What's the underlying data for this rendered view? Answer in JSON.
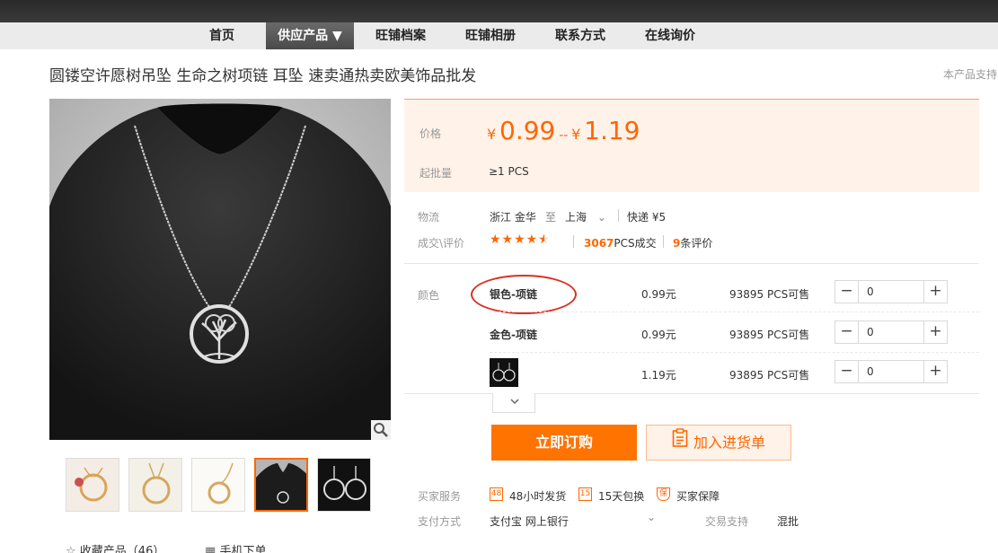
{
  "nav": {
    "items": [
      "首页",
      "供应产品 ▼",
      "旺铺档案",
      "旺铺相册",
      "联系方式",
      "在线询价"
    ]
  },
  "product": {
    "title": "圆镂空许愿树吊坠 生命之树项链 耳坠 速卖通热卖欧美饰品批发",
    "support_text": "本产品支持"
  },
  "price": {
    "label": "价格",
    "currency": "¥",
    "min": "0.99",
    "sep": "--",
    "max": "1.19",
    "moq_label": "起批量",
    "moq_value": "≥1  PCS"
  },
  "logistics": {
    "label": "物流",
    "from": "浙江 金华",
    "to_word": "至",
    "to": "上海",
    "express": "快递 ¥5"
  },
  "deals": {
    "label": "成交\\评价",
    "rating": 4.5,
    "sold_count": "3067",
    "sold_unit": "PCS成交",
    "review_count": "9",
    "review_unit": "条评价"
  },
  "variants": {
    "label": "颜色",
    "rows": [
      {
        "name": "银色-项链",
        "price": "0.99元",
        "stock": "93895 PCS可售",
        "qty": "0"
      },
      {
        "name": "金色-项链",
        "price": "0.99元",
        "stock": "93895 PCS可售",
        "qty": "0"
      },
      {
        "name": "",
        "price": "1.19元",
        "stock": "93895 PCS可售",
        "qty": "0"
      }
    ]
  },
  "actions": {
    "buy": "立即订购",
    "cart": "加入进货单"
  },
  "services": {
    "label": "买家服务",
    "items": [
      {
        "icon": "48",
        "text": "48小时发货"
      },
      {
        "icon": "15",
        "text": "15天包换"
      },
      {
        "icon": "保",
        "text": "买家保障"
      }
    ]
  },
  "payment": {
    "label": "支付方式",
    "methods": "支付宝  网上银行",
    "trade_label": "交易支持",
    "trade_value": "混批"
  },
  "bottom": {
    "favorite": "收藏产品（46）",
    "mobile": "手机下单"
  },
  "colors": {
    "accent": "#ff6600",
    "buy_button": "#ff7300",
    "price_bg": "#fff2e8",
    "star": "#ff6600",
    "annotation": "#d93025"
  }
}
